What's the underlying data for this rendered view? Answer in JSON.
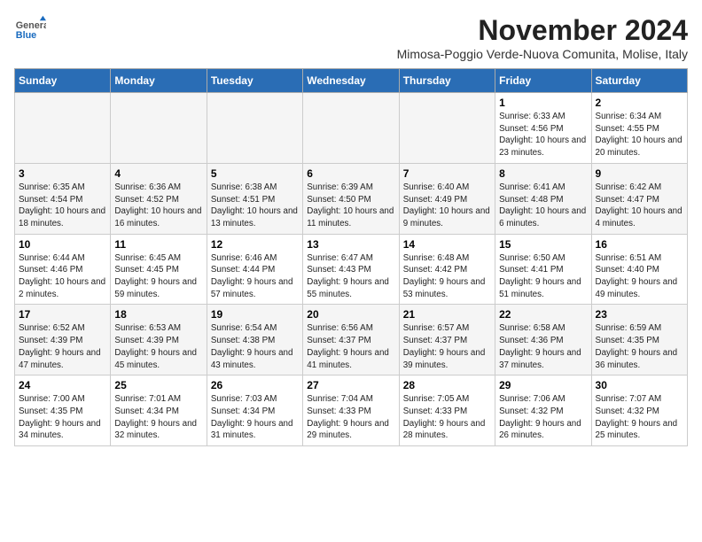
{
  "header": {
    "logo_general": "General",
    "logo_blue": "Blue",
    "month_title": "November 2024",
    "subtitle": "Mimosa-Poggio Verde-Nuova Comunita, Molise, Italy"
  },
  "columns": [
    "Sunday",
    "Monday",
    "Tuesday",
    "Wednesday",
    "Thursday",
    "Friday",
    "Saturday"
  ],
  "weeks": [
    {
      "days": [
        {
          "num": "",
          "info": ""
        },
        {
          "num": "",
          "info": ""
        },
        {
          "num": "",
          "info": ""
        },
        {
          "num": "",
          "info": ""
        },
        {
          "num": "",
          "info": ""
        },
        {
          "num": "1",
          "info": "Sunrise: 6:33 AM\nSunset: 4:56 PM\nDaylight: 10 hours and 23 minutes."
        },
        {
          "num": "2",
          "info": "Sunrise: 6:34 AM\nSunset: 4:55 PM\nDaylight: 10 hours and 20 minutes."
        }
      ]
    },
    {
      "days": [
        {
          "num": "3",
          "info": "Sunrise: 6:35 AM\nSunset: 4:54 PM\nDaylight: 10 hours and 18 minutes."
        },
        {
          "num": "4",
          "info": "Sunrise: 6:36 AM\nSunset: 4:52 PM\nDaylight: 10 hours and 16 minutes."
        },
        {
          "num": "5",
          "info": "Sunrise: 6:38 AM\nSunset: 4:51 PM\nDaylight: 10 hours and 13 minutes."
        },
        {
          "num": "6",
          "info": "Sunrise: 6:39 AM\nSunset: 4:50 PM\nDaylight: 10 hours and 11 minutes."
        },
        {
          "num": "7",
          "info": "Sunrise: 6:40 AM\nSunset: 4:49 PM\nDaylight: 10 hours and 9 minutes."
        },
        {
          "num": "8",
          "info": "Sunrise: 6:41 AM\nSunset: 4:48 PM\nDaylight: 10 hours and 6 minutes."
        },
        {
          "num": "9",
          "info": "Sunrise: 6:42 AM\nSunset: 4:47 PM\nDaylight: 10 hours and 4 minutes."
        }
      ]
    },
    {
      "days": [
        {
          "num": "10",
          "info": "Sunrise: 6:44 AM\nSunset: 4:46 PM\nDaylight: 10 hours and 2 minutes."
        },
        {
          "num": "11",
          "info": "Sunrise: 6:45 AM\nSunset: 4:45 PM\nDaylight: 9 hours and 59 minutes."
        },
        {
          "num": "12",
          "info": "Sunrise: 6:46 AM\nSunset: 4:44 PM\nDaylight: 9 hours and 57 minutes."
        },
        {
          "num": "13",
          "info": "Sunrise: 6:47 AM\nSunset: 4:43 PM\nDaylight: 9 hours and 55 minutes."
        },
        {
          "num": "14",
          "info": "Sunrise: 6:48 AM\nSunset: 4:42 PM\nDaylight: 9 hours and 53 minutes."
        },
        {
          "num": "15",
          "info": "Sunrise: 6:50 AM\nSunset: 4:41 PM\nDaylight: 9 hours and 51 minutes."
        },
        {
          "num": "16",
          "info": "Sunrise: 6:51 AM\nSunset: 4:40 PM\nDaylight: 9 hours and 49 minutes."
        }
      ]
    },
    {
      "days": [
        {
          "num": "17",
          "info": "Sunrise: 6:52 AM\nSunset: 4:39 PM\nDaylight: 9 hours and 47 minutes."
        },
        {
          "num": "18",
          "info": "Sunrise: 6:53 AM\nSunset: 4:39 PM\nDaylight: 9 hours and 45 minutes."
        },
        {
          "num": "19",
          "info": "Sunrise: 6:54 AM\nSunset: 4:38 PM\nDaylight: 9 hours and 43 minutes."
        },
        {
          "num": "20",
          "info": "Sunrise: 6:56 AM\nSunset: 4:37 PM\nDaylight: 9 hours and 41 minutes."
        },
        {
          "num": "21",
          "info": "Sunrise: 6:57 AM\nSunset: 4:37 PM\nDaylight: 9 hours and 39 minutes."
        },
        {
          "num": "22",
          "info": "Sunrise: 6:58 AM\nSunset: 4:36 PM\nDaylight: 9 hours and 37 minutes."
        },
        {
          "num": "23",
          "info": "Sunrise: 6:59 AM\nSunset: 4:35 PM\nDaylight: 9 hours and 36 minutes."
        }
      ]
    },
    {
      "days": [
        {
          "num": "24",
          "info": "Sunrise: 7:00 AM\nSunset: 4:35 PM\nDaylight: 9 hours and 34 minutes."
        },
        {
          "num": "25",
          "info": "Sunrise: 7:01 AM\nSunset: 4:34 PM\nDaylight: 9 hours and 32 minutes."
        },
        {
          "num": "26",
          "info": "Sunrise: 7:03 AM\nSunset: 4:34 PM\nDaylight: 9 hours and 31 minutes."
        },
        {
          "num": "27",
          "info": "Sunrise: 7:04 AM\nSunset: 4:33 PM\nDaylight: 9 hours and 29 minutes."
        },
        {
          "num": "28",
          "info": "Sunrise: 7:05 AM\nSunset: 4:33 PM\nDaylight: 9 hours and 28 minutes."
        },
        {
          "num": "29",
          "info": "Sunrise: 7:06 AM\nSunset: 4:32 PM\nDaylight: 9 hours and 26 minutes."
        },
        {
          "num": "30",
          "info": "Sunrise: 7:07 AM\nSunset: 4:32 PM\nDaylight: 9 hours and 25 minutes."
        }
      ]
    }
  ]
}
